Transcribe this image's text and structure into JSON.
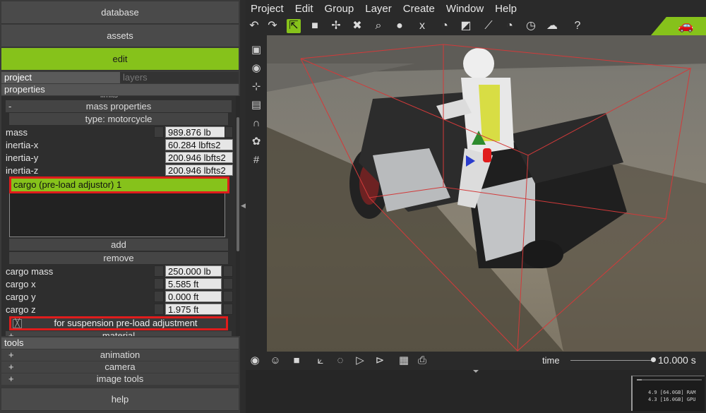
{
  "left_panel": {
    "buttons": {
      "database": "database",
      "assets": "assets",
      "edit": "edit",
      "help": "help"
    },
    "tabs": {
      "project": "project",
      "layers": "layers"
    },
    "properties_header": "properties",
    "clipped_section_label": "limits",
    "mass_properties": {
      "sign": "-",
      "title": "mass properties",
      "type_label": "type: motorcycle",
      "fields": [
        {
          "label": "mass",
          "value": "989.876 lb"
        },
        {
          "label": "inertia-x",
          "value": "60.284 lbfts2"
        },
        {
          "label": "inertia-y",
          "value": "200.946 lbfts2"
        },
        {
          "label": "inertia-z",
          "value": "200.946 lbfts2"
        }
      ],
      "cargo_list_selected": "cargo (pre-load adjustor) 1",
      "add_label": "add",
      "remove_label": "remove",
      "cargo_fields": [
        {
          "label": "cargo mass",
          "value": "250.000 lb"
        },
        {
          "label": "cargo x",
          "value": "5.585 ft"
        },
        {
          "label": "cargo y",
          "value": "0.000 ft"
        },
        {
          "label": "cargo z",
          "value": "1.975 ft"
        }
      ],
      "checkbox_label": "for suspension pre-load adjustment",
      "checkbox_mark": "╳",
      "next_section_sign": "+",
      "next_section_label": "material"
    },
    "tools_header": "tools",
    "tool_items": [
      {
        "sign": "+",
        "label": "animation"
      },
      {
        "sign": "+",
        "label": "camera"
      },
      {
        "sign": "+",
        "label": "image tools"
      }
    ]
  },
  "menubar": [
    "Project",
    "Edit",
    "Group",
    "Layer",
    "Create",
    "Window",
    "Help"
  ],
  "toolbar_icons": [
    "undo-icon",
    "redo-icon",
    "select-add-icon",
    "box-select-icon",
    "transform-icon",
    "delete-icon",
    "zoom-icon",
    "figure-icon",
    "x-axis-icon",
    "gauge-icon",
    "tag-icon",
    "path-icon",
    "gauge-2-icon",
    "clock-icon",
    "group-icon",
    "help-icon"
  ],
  "bottom": {
    "time_label": "time",
    "time_value": "10.000 s",
    "time_fraction": 1.0
  },
  "memory": {
    "ram_line": "4.9 [64.0GB] RAM",
    "gpu_line": "4.3 [16.0GB] GPU",
    "ram_fraction": 0.08
  },
  "colors": {
    "accent": "#86c21b",
    "highlight": "#e01c1c",
    "bounding_box": "#d23a3a"
  }
}
